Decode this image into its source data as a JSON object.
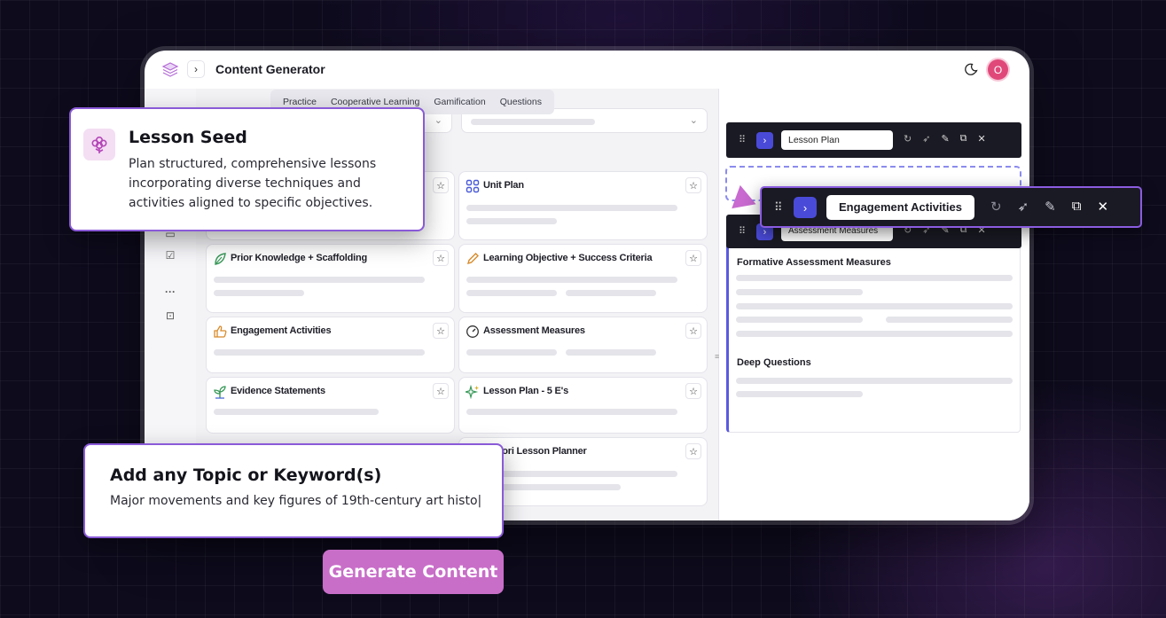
{
  "app": {
    "title": "Content Generator",
    "avatar_initial": "O"
  },
  "tabs": [
    "Practice",
    "Cooperative Learning",
    "Gamification",
    "Questions"
  ],
  "cards": [
    {
      "label": "Unit Plan",
      "icon": "unit-plan-icon"
    },
    {
      "label": "Prior Knowledge + Scaffolding",
      "icon": "leaf-icon"
    },
    {
      "label": "Learning Objective + Success Criteria",
      "icon": "pencil-icon"
    },
    {
      "label": "Engagement Activities",
      "icon": "thumbs-up-icon"
    },
    {
      "label": "Assessment Measures",
      "icon": "gauge-icon"
    },
    {
      "label": "Evidence Statements",
      "icon": "sprout-icon"
    },
    {
      "label": "Lesson Plan - 5 E's",
      "icon": "sparkle-icon"
    },
    {
      "label": "tessori Lesson Planner",
      "icon": ""
    }
  ],
  "right_panel": {
    "block1_name": "Lesson Plan",
    "block2_name": "Assessment Measures",
    "section1": "Formative Assessment Measures",
    "section2": "Deep Questions"
  },
  "floating_block": {
    "name": "Engagement Activities"
  },
  "lesson_seed": {
    "title": "Lesson Seed",
    "description": "Plan structured, comprehensive lessons incorporating diverse techniques and activities aligned to specific objectives."
  },
  "topic": {
    "title": "Add any Topic or Keyword(s)",
    "value": "Major movements and key figures of 19th-century art histo|"
  },
  "generate_button": "Generate Content",
  "colors": {
    "accent": "#4a4ad8",
    "popup_border": "#8a5ad8",
    "generate": "#c86ec8",
    "background": "#0e0b1d"
  }
}
